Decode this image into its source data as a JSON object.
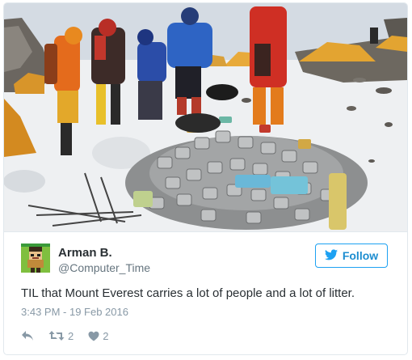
{
  "tweet": {
    "author_name": "Arman B.",
    "author_handle": "@Computer_Time",
    "follow_label": "Follow",
    "text": "TIL that Mount Everest carries a lot of people and a lot of litter.",
    "timestamp": "3:43 PM - 19 Feb 2016",
    "retweet_count": "2",
    "like_count": "2"
  },
  "colors": {
    "accent": "#1da1f2",
    "text": "#292f33",
    "muted": "#8899a6"
  },
  "icons": {
    "follow": "twitter-bird-icon",
    "reply": "reply-icon",
    "retweet": "retweet-icon",
    "like": "heart-icon"
  }
}
